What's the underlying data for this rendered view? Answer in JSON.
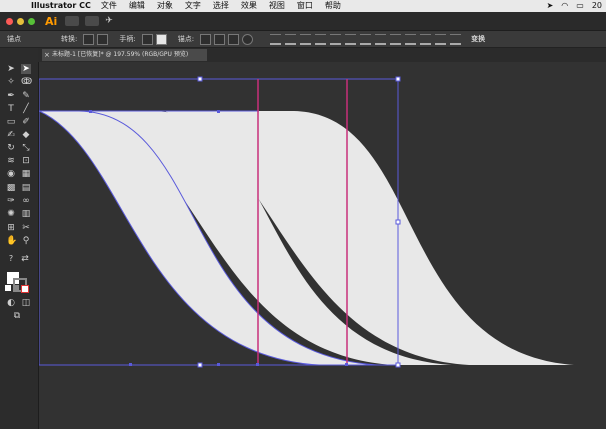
{
  "menubar": {
    "app_name": "Illustrator CC",
    "items": [
      "文件",
      "编辑",
      "对象",
      "文字",
      "选择",
      "效果",
      "视图",
      "窗口",
      "帮助"
    ],
    "status_text": "20"
  },
  "app": {
    "logo": "Ai"
  },
  "control_bar": {
    "anchor_label": "锚点",
    "convert_label": "转换:",
    "handles_label": "手柄:",
    "anchors_label": "锚点:",
    "transform_label": "变换"
  },
  "document_tab": {
    "title": "未标题-1 [已恢复]* @ 197.59% (RGB/GPU 预览)"
  },
  "colors": {
    "canvas_bg": "#323232",
    "shape_fill": "#e8e8e8",
    "selection": "#5a5adb",
    "guide": "#c7307b"
  },
  "icons": [
    "apple-icon",
    "wifi-icon",
    "battery-icon",
    "selection-tool-icon",
    "direct-selection-tool-icon",
    "pen-tool-icon",
    "type-tool-icon",
    "line-tool-icon",
    "rectangle-tool-icon",
    "paintbrush-tool-icon",
    "pencil-tool-icon",
    "eraser-tool-icon",
    "rotate-tool-icon",
    "scale-tool-icon",
    "width-tool-icon",
    "warp-tool-icon",
    "shape-builder-icon",
    "perspective-grid-icon",
    "mesh-tool-icon",
    "gradient-tool-icon",
    "eyedropper-tool-icon",
    "blend-tool-icon",
    "symbol-sprayer-icon",
    "column-graph-icon",
    "artboard-tool-icon",
    "slice-tool-icon",
    "hand-tool-icon",
    "zoom-tool-icon",
    "fill-swatch-icon",
    "stroke-swatch-icon",
    "draw-mode-icon",
    "screen-mode-icon"
  ]
}
